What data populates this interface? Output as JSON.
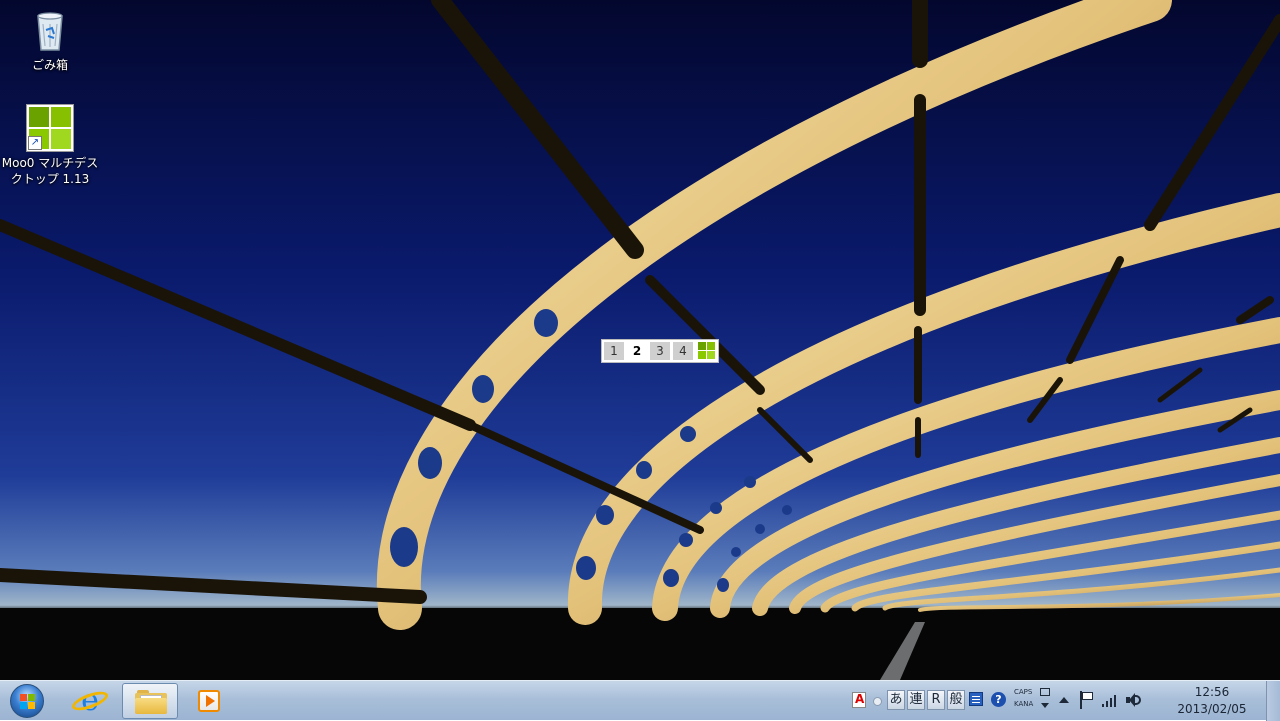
{
  "desktop": {
    "icons": [
      {
        "label": "ごみ箱",
        "icon": "recycle-bin-icon"
      },
      {
        "label": "Moo0 マルチデスクトップ 1.13",
        "label_line1": "Moo0 マルチデス",
        "label_line2": "クトップ 1.13",
        "icon": "moo0-multidesktop-icon"
      }
    ]
  },
  "virtual_desktop_switcher": {
    "desktops": [
      "1",
      "2",
      "3",
      "4"
    ],
    "active": "2",
    "grid_icon": "desktop-grid-icon",
    "colors": {
      "grid": "#7cb800",
      "inactive": "#cfcfcf"
    }
  },
  "taskbar": {
    "start_icon": "windows-start-icon",
    "pinned": [
      {
        "name": "Internet Explorer",
        "icon": "internet-explorer-icon",
        "active": false
      },
      {
        "name": "Windows Explorer",
        "icon": "folder-icon",
        "active": true
      },
      {
        "name": "Windows Media Player",
        "icon": "media-player-icon",
        "active": false
      }
    ],
    "tray": {
      "ime": {
        "mode_label": "あ",
        "conversion_label": "連",
        "r_label": "R",
        "dictionary_label": "般",
        "caps_label": "CAPS",
        "kana_label": "KANA"
      },
      "icons": [
        "adobe-acrobat-icon",
        "ime-dot-icon",
        "ime-pad-icon",
        "help-icon",
        "show-hidden-icons-chevron",
        "action-center-flag-icon",
        "network-signal-icon",
        "volume-icon"
      ]
    },
    "clock": {
      "time": "12:56",
      "date": "2013/02/05"
    }
  }
}
